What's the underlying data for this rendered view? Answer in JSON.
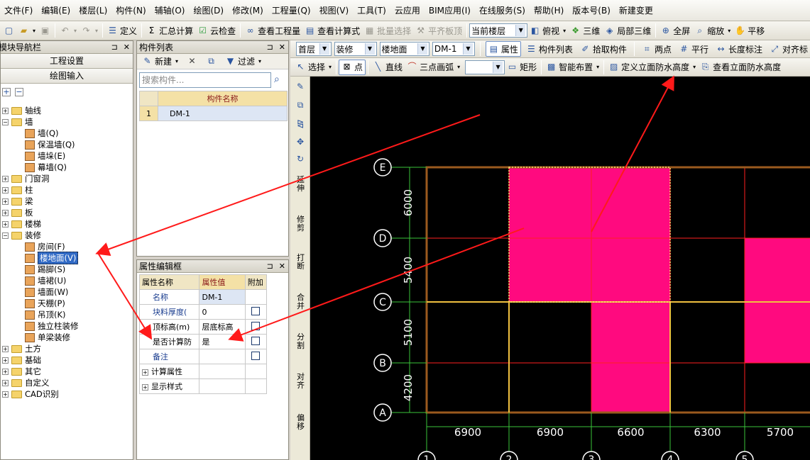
{
  "menu": [
    "文件(F)",
    "编辑(E)",
    "楼层(L)",
    "构件(N)",
    "辅轴(O)",
    "绘图(D)",
    "修改(M)",
    "工程量(Q)",
    "视图(V)",
    "工具(T)",
    "云应用",
    "BIM应用(I)",
    "在线服务(S)",
    "帮助(H)",
    "版本号(B)",
    "新建变更"
  ],
  "toolbar1": {
    "define": "定义",
    "sum": "汇总计算",
    "cloud_check": "云检查",
    "view_qty": "查看工程量",
    "view_formula": "查看计算式",
    "batch_select": "批量选择",
    "align_board": "平齐板顶",
    "floor_combo": "当前楼层",
    "top_view": "俯视",
    "three_d": "三维",
    "local_3d": "局部三维",
    "fullscreen": "全屏",
    "zoom": "缩放",
    "pan": "平移"
  },
  "nav": {
    "title": "模块导航栏",
    "btn_settings": "工程设置",
    "btn_draw": "绘图输入",
    "tree": [
      {
        "label": "轴线",
        "kind": "folder",
        "exp": "+",
        "depth": 0
      },
      {
        "label": "墙",
        "kind": "folder",
        "exp": "-",
        "depth": 0
      },
      {
        "label": "墙(Q)",
        "kind": "leaf",
        "depth": 1
      },
      {
        "label": "保温墙(Q)",
        "kind": "leaf",
        "depth": 1
      },
      {
        "label": "墙垛(E)",
        "kind": "leaf",
        "depth": 1
      },
      {
        "label": "幕墙(Q)",
        "kind": "leaf",
        "depth": 1
      },
      {
        "label": "门窗洞",
        "kind": "folder",
        "exp": "+",
        "depth": 0
      },
      {
        "label": "柱",
        "kind": "folder",
        "exp": "+",
        "depth": 0
      },
      {
        "label": "梁",
        "kind": "folder",
        "exp": "+",
        "depth": 0
      },
      {
        "label": "板",
        "kind": "folder",
        "exp": "+",
        "depth": 0
      },
      {
        "label": "楼梯",
        "kind": "folder",
        "exp": "+",
        "depth": 0
      },
      {
        "label": "装修",
        "kind": "folder",
        "exp": "-",
        "depth": 0
      },
      {
        "label": "房间(F)",
        "kind": "leaf",
        "depth": 1
      },
      {
        "label": "楼地面(V)",
        "kind": "leaf",
        "depth": 1,
        "selected": true
      },
      {
        "label": "踢脚(S)",
        "kind": "leaf",
        "depth": 1
      },
      {
        "label": "墙裙(U)",
        "kind": "leaf",
        "depth": 1
      },
      {
        "label": "墙面(W)",
        "kind": "leaf",
        "depth": 1
      },
      {
        "label": "天棚(P)",
        "kind": "leaf",
        "depth": 1
      },
      {
        "label": "吊顶(K)",
        "kind": "leaf",
        "depth": 1
      },
      {
        "label": "独立柱装修",
        "kind": "leaf",
        "depth": 1
      },
      {
        "label": "单梁装修",
        "kind": "leaf",
        "depth": 1
      },
      {
        "label": "土方",
        "kind": "folder",
        "exp": "+",
        "depth": 0
      },
      {
        "label": "基础",
        "kind": "folder",
        "exp": "+",
        "depth": 0
      },
      {
        "label": "其它",
        "kind": "folder",
        "exp": "+",
        "depth": 0
      },
      {
        "label": "自定义",
        "kind": "folder",
        "exp": "+",
        "depth": 0
      },
      {
        "label": "CAD识别",
        "kind": "folder",
        "exp": "+",
        "depth": 0
      }
    ]
  },
  "component_list": {
    "title": "构件列表",
    "new": "新建",
    "filter": "过滤",
    "search_placeholder": "搜索构件...",
    "col_name": "构件名称",
    "rows": [
      {
        "no": "1",
        "name": "DM-1"
      }
    ]
  },
  "props": {
    "title": "属性编辑框",
    "col_name": "属性名称",
    "col_value": "属性值",
    "col_extra": "附加",
    "rows": [
      {
        "name": "名称",
        "value": "DM-1",
        "check": false,
        "blue": true
      },
      {
        "name": "块料厚度(",
        "value": "0",
        "check": true,
        "blue": true
      },
      {
        "name": "顶标高(m)",
        "value": "层底标高",
        "check": true,
        "blue": false
      },
      {
        "name": "是否计算防",
        "value": "是",
        "check": true,
        "blue": false
      },
      {
        "name": "备注",
        "value": "",
        "check": true,
        "blue": true
      }
    ],
    "groups": [
      "计算属性",
      "显示样式"
    ]
  },
  "row2": {
    "floor": "首层",
    "type": "装修",
    "sub": "楼地面",
    "comp": "DM-1",
    "attr": "属性",
    "comp_list": "构件列表",
    "pick": "拾取构件",
    "two_point": "两点",
    "parallel": "平行",
    "length_dim": "长度标注",
    "align_dim": "对齐标"
  },
  "row3": {
    "select": "选择",
    "point": "点",
    "line": "直线",
    "arc": "三点画弧",
    "rect": "矩形",
    "smart": "智能布置",
    "define_wp": "定义立面防水高度",
    "view_wp": "查看立面防水高度"
  },
  "vtool": [
    {
      "t": "延伸"
    },
    {
      "t": "修剪"
    },
    {
      "t": "打断"
    },
    {
      "t": "合并"
    },
    {
      "t": "分割"
    },
    {
      "t": "对齐"
    },
    {
      "t": "偏移"
    }
  ],
  "drawing": {
    "row_axes": [
      "E",
      "D",
      "C",
      "B",
      "A"
    ],
    "col_axes": [
      "1",
      "2",
      "3",
      "4",
      "5"
    ],
    "row_dims": [
      "6000",
      "5400",
      "5100",
      "4200"
    ],
    "col_dims": [
      "6900",
      "6900",
      "6600",
      "6300",
      "5700"
    ],
    "fill_color": "#ff0a7f"
  }
}
